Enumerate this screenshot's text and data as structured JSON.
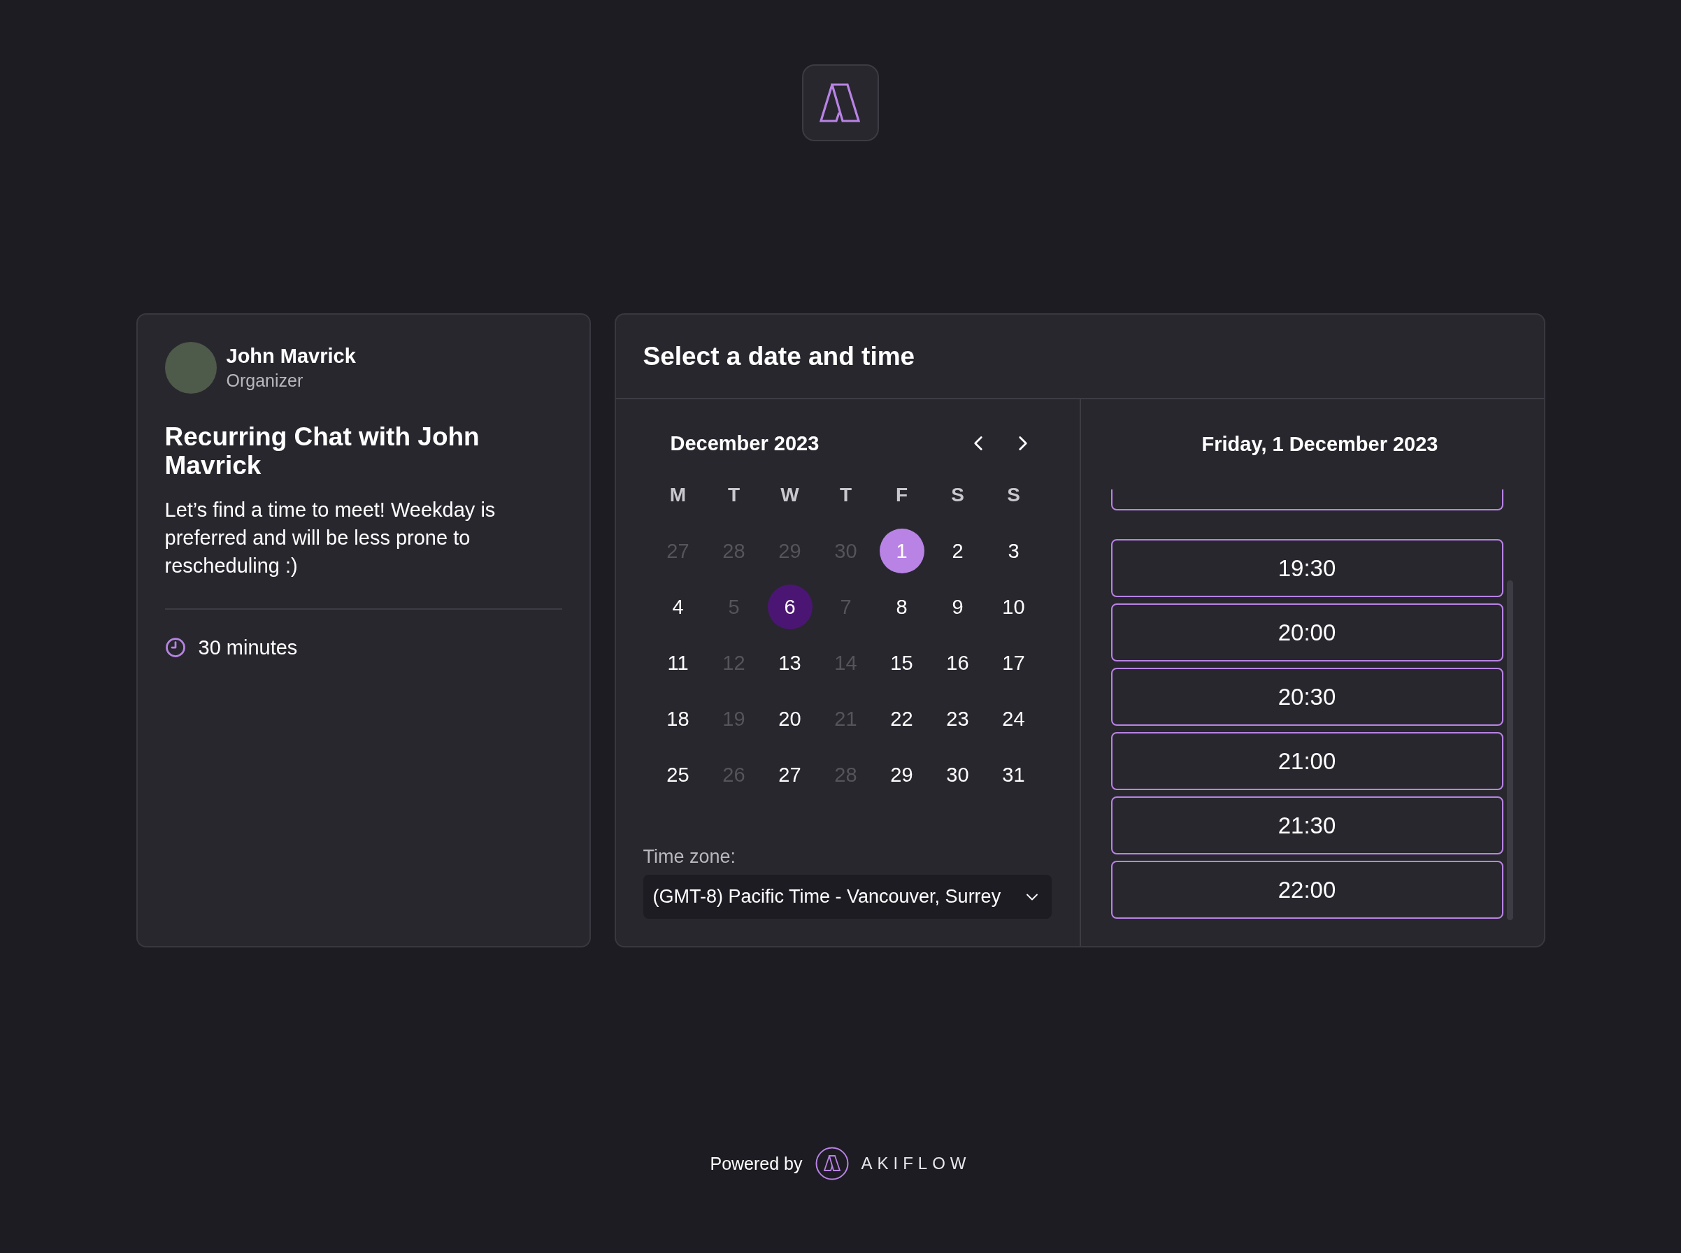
{
  "organizer": {
    "name": "John Mavrick",
    "role": "Organizer"
  },
  "event": {
    "title": "Recurring Chat with John Mavrick",
    "description": "Let’s find a time to meet! Weekday is preferred and will be less prone to rescheduling :)",
    "duration": "30 minutes"
  },
  "scheduler": {
    "title": "Select a date and time",
    "calendar": {
      "month": "December 2023",
      "weekdays": [
        "M",
        "T",
        "W",
        "T",
        "F",
        "S",
        "S"
      ],
      "days": [
        {
          "label": "27",
          "disabled": true,
          "selected": false,
          "today": false
        },
        {
          "label": "28",
          "disabled": true,
          "selected": false,
          "today": false
        },
        {
          "label": "29",
          "disabled": true,
          "selected": false,
          "today": false
        },
        {
          "label": "30",
          "disabled": true,
          "selected": false,
          "today": false
        },
        {
          "label": "1",
          "disabled": false,
          "selected": true,
          "today": false
        },
        {
          "label": "2",
          "disabled": false,
          "selected": false,
          "today": false
        },
        {
          "label": "3",
          "disabled": false,
          "selected": false,
          "today": false
        },
        {
          "label": "4",
          "disabled": false,
          "selected": false,
          "today": false
        },
        {
          "label": "5",
          "disabled": true,
          "selected": false,
          "today": false
        },
        {
          "label": "6",
          "disabled": false,
          "selected": false,
          "today": true
        },
        {
          "label": "7",
          "disabled": true,
          "selected": false,
          "today": false
        },
        {
          "label": "8",
          "disabled": false,
          "selected": false,
          "today": false
        },
        {
          "label": "9",
          "disabled": false,
          "selected": false,
          "today": false
        },
        {
          "label": "10",
          "disabled": false,
          "selected": false,
          "today": false
        },
        {
          "label": "11",
          "disabled": false,
          "selected": false,
          "today": false
        },
        {
          "label": "12",
          "disabled": true,
          "selected": false,
          "today": false
        },
        {
          "label": "13",
          "disabled": false,
          "selected": false,
          "today": false
        },
        {
          "label": "14",
          "disabled": true,
          "selected": false,
          "today": false
        },
        {
          "label": "15",
          "disabled": false,
          "selected": false,
          "today": false
        },
        {
          "label": "16",
          "disabled": false,
          "selected": false,
          "today": false
        },
        {
          "label": "17",
          "disabled": false,
          "selected": false,
          "today": false
        },
        {
          "label": "18",
          "disabled": false,
          "selected": false,
          "today": false
        },
        {
          "label": "19",
          "disabled": true,
          "selected": false,
          "today": false
        },
        {
          "label": "20",
          "disabled": false,
          "selected": false,
          "today": false
        },
        {
          "label": "21",
          "disabled": true,
          "selected": false,
          "today": false
        },
        {
          "label": "22",
          "disabled": false,
          "selected": false,
          "today": false
        },
        {
          "label": "23",
          "disabled": false,
          "selected": false,
          "today": false
        },
        {
          "label": "24",
          "disabled": false,
          "selected": false,
          "today": false
        },
        {
          "label": "25",
          "disabled": false,
          "selected": false,
          "today": false
        },
        {
          "label": "26",
          "disabled": true,
          "selected": false,
          "today": false
        },
        {
          "label": "27",
          "disabled": false,
          "selected": false,
          "today": false
        },
        {
          "label": "28",
          "disabled": true,
          "selected": false,
          "today": false
        },
        {
          "label": "29",
          "disabled": false,
          "selected": false,
          "today": false
        },
        {
          "label": "30",
          "disabled": false,
          "selected": false,
          "today": false
        },
        {
          "label": "31",
          "disabled": false,
          "selected": false,
          "today": false
        }
      ]
    },
    "timezone": {
      "label": "Time zone:",
      "value": "(GMT-8) Pacific Time - Vancouver, Surrey"
    },
    "slots_panel": {
      "date": "Friday, 1 December 2023",
      "slot_above_cut": true,
      "slots": [
        {
          "time": "19:30",
          "selected": false
        },
        {
          "time": "20:00",
          "selected": false
        },
        {
          "time": "20:30",
          "selected": false
        },
        {
          "time": "21:00",
          "selected": false
        },
        {
          "time": "21:30",
          "selected": false
        },
        {
          "time": "22:00",
          "selected": false
        }
      ]
    }
  },
  "footer": {
    "text": "Powered by",
    "brand": "AKIFLOW"
  }
}
